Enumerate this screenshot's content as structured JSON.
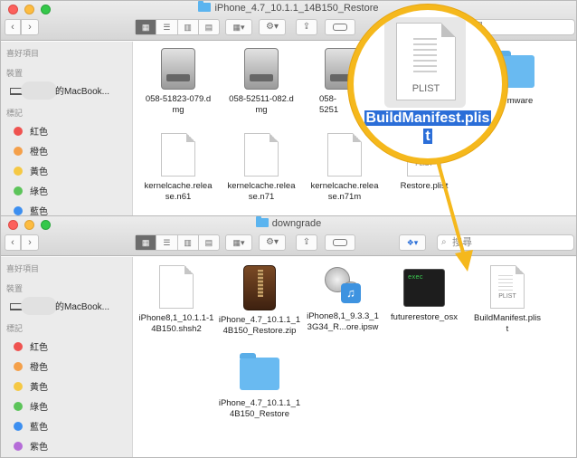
{
  "top_window": {
    "title": "iPhone_4.7_10.1.1_14B150_Restore",
    "search_placeholder": "搜尋",
    "sidebar": {
      "favorites_label": "喜好項目",
      "devices_label": "裝置",
      "device_name": "的MacBook...",
      "tags_label": "標記",
      "tags": [
        {
          "label": "紅色",
          "color": "#ef5350"
        },
        {
          "label": "橙色",
          "color": "#f4a04a"
        },
        {
          "label": "黃色",
          "color": "#f5c844"
        },
        {
          "label": "綠色",
          "color": "#5cc45a"
        },
        {
          "label": "藍色",
          "color": "#3d8ff0"
        }
      ]
    },
    "files": [
      {
        "line1": "058-51823-079.d",
        "line2": "mg",
        "icon": "dmg-icon"
      },
      {
        "line1": "058-52511-082.d",
        "line2": "mg",
        "icon": "dmg-icon"
      },
      {
        "line1": "058-5251",
        "line2": "",
        "icon": "dmg-icon"
      },
      {
        "line1": "mware",
        "line2": "",
        "icon": "folder-icon"
      },
      {
        "line1": "kernelcache.relea",
        "line2": "se.n61",
        "icon": "document-icon"
      },
      {
        "line1": "kernelcache.relea",
        "line2": "se.n71",
        "icon": "document-icon"
      },
      {
        "line1": "kernelcache.relea",
        "line2": "se.n71m",
        "icon": "document-icon"
      },
      {
        "line1": "Restore.plist",
        "line2": "",
        "icon": "plist-icon"
      }
    ],
    "magnifier": {
      "file_type": "PLIST",
      "label_line1": "BuildManifest.plis",
      "label_line2": "t"
    }
  },
  "bottom_window": {
    "title": "downgrade",
    "search_placeholder": "搜尋",
    "sidebar": {
      "favorites_label": "喜好項目",
      "devices_label": "裝置",
      "device_name": "的MacBook...",
      "tags_label": "標記",
      "tags": [
        {
          "label": "紅色",
          "color": "#ef5350"
        },
        {
          "label": "橙色",
          "color": "#f4a04a"
        },
        {
          "label": "黃色",
          "color": "#f5c844"
        },
        {
          "label": "綠色",
          "color": "#5cc45a"
        },
        {
          "label": "藍色",
          "color": "#3d8ff0"
        },
        {
          "label": "紫色",
          "color": "#b56cd8"
        }
      ]
    },
    "files": [
      {
        "line1": "iPhone8,1_10.1.1-1",
        "line2": "4B150.shsh2",
        "icon": "document-icon"
      },
      {
        "line1": "iPhone_4.7_10.1.1_1",
        "line2": "4B150_Restore.zip",
        "icon": "zip-icon"
      },
      {
        "line1": "iPhone8,1_9.3.3_1",
        "line2": "3G34_R...ore.ipsw",
        "icon": "ipsw-icon"
      },
      {
        "line1": "futurerestore_osx",
        "line2": "",
        "icon": "exec-icon"
      },
      {
        "line1": "BuildManifest.plis",
        "line2": "t",
        "icon": "plist-icon"
      },
      {
        "line1": "iPhone_4.7_10.1.1_1",
        "line2": "4B150_Restore",
        "icon": "folder-icon"
      }
    ],
    "exec_text": "exec",
    "plist_text": "PLIST"
  },
  "colors": {
    "accent": "#f5b81c",
    "selection": "#2b6ed8"
  }
}
